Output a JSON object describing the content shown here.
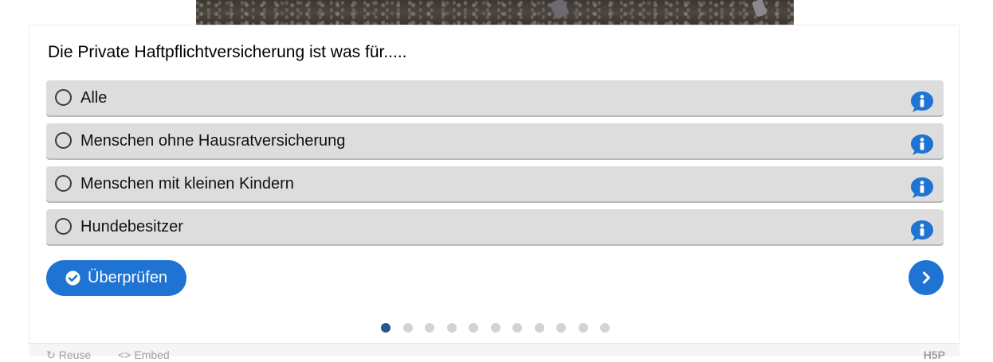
{
  "question": "Die Private Haftpflichtversicherung ist was für.....",
  "answers": [
    {
      "label": "Alle"
    },
    {
      "label": "Menschen ohne Hausratversicherung"
    },
    {
      "label": "Menschen mit kleinen Kindern"
    },
    {
      "label": "Hundebesitzer"
    }
  ],
  "check_button": {
    "label": "Überprüfen"
  },
  "progress": {
    "total": 11,
    "current": 1
  },
  "footer": {
    "reuse": "Reuse",
    "embed": "Embed",
    "brand": "H5P"
  },
  "colors": {
    "accent": "#1f73d3",
    "answer_bg": "#dddddd",
    "active_dot": "#285491",
    "info": "#1f73d3"
  },
  "icons": {
    "info": "info-bubble-icon",
    "check": "check-circle-icon",
    "next": "chevron-right-icon",
    "radio": "radio-empty-icon"
  }
}
